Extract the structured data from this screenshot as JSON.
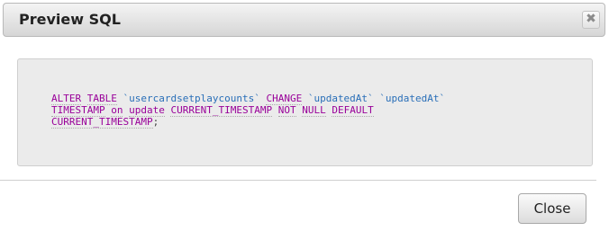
{
  "dialog": {
    "title": "Preview SQL",
    "close_icon": "close-icon",
    "close_glyph": "✖",
    "sql": {
      "line1": [
        {
          "t": "ALTER",
          "k": "kw"
        },
        {
          "t": " ",
          "k": "punct"
        },
        {
          "t": "TABLE",
          "k": "kw"
        },
        {
          "t": " `usercardsetplaycounts` ",
          "k": "ident"
        },
        {
          "t": "CHANGE",
          "k": "kw"
        },
        {
          "t": " `updatedAt` `updatedAt`",
          "k": "ident"
        }
      ],
      "line2": [
        {
          "t": "TIMESTAMP",
          "k": "kw"
        },
        {
          "t": " ",
          "k": "punct"
        },
        {
          "t": "on",
          "k": "kw"
        },
        {
          "t": " ",
          "k": "punct"
        },
        {
          "t": "update",
          "k": "kw"
        },
        {
          "t": " ",
          "k": "punct"
        },
        {
          "t": "CURRENT_TIMESTAMP",
          "k": "kw"
        },
        {
          "t": " ",
          "k": "punct"
        },
        {
          "t": "NOT",
          "k": "kw"
        },
        {
          "t": " ",
          "k": "punct"
        },
        {
          "t": "NULL",
          "k": "kw"
        },
        {
          "t": " ",
          "k": "punct"
        },
        {
          "t": "DEFAULT",
          "k": "kw"
        }
      ],
      "line3": [
        {
          "t": "CURRENT_TIMESTAMP",
          "k": "kw"
        },
        {
          "t": ";",
          "k": "punct"
        }
      ]
    },
    "close_button_label": "Close"
  }
}
